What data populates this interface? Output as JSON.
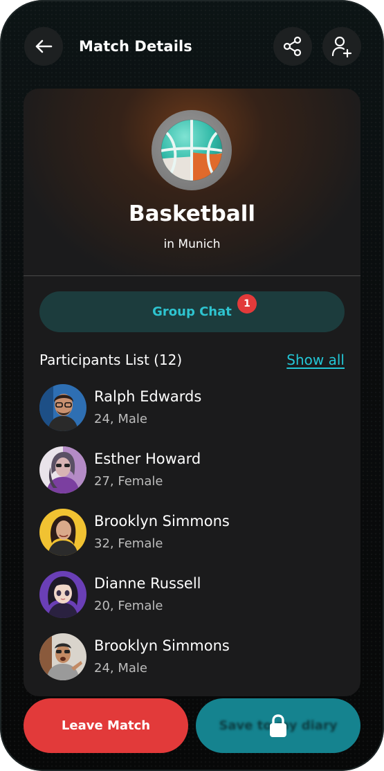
{
  "header": {
    "title": "Match Details"
  },
  "match": {
    "sport": "Basketball",
    "location": "in Munich"
  },
  "group_chat": {
    "label": "Group Chat",
    "badge_count": "1"
  },
  "participants": {
    "title": "Participants List (12)",
    "show_all_label": "Show all",
    "items": [
      {
        "name": "Ralph Edwards",
        "meta": "24, Male"
      },
      {
        "name": "Esther Howard",
        "meta": "27, Female"
      },
      {
        "name": "Brooklyn Simmons",
        "meta": "32, Female"
      },
      {
        "name": "Dianne Russell",
        "meta": "20, Female"
      },
      {
        "name": "Brooklyn Simmons",
        "meta": "24, Male"
      }
    ]
  },
  "actions": {
    "leave_label": "Leave Match",
    "save_label": "Save to my diary"
  },
  "colors": {
    "accent": "#23c6d6",
    "danger": "#e23a3a",
    "save_button": "#15838f"
  },
  "icons": [
    "back-arrow-icon",
    "share-icon",
    "add-user-icon",
    "basketball-icon",
    "lock-icon"
  ]
}
